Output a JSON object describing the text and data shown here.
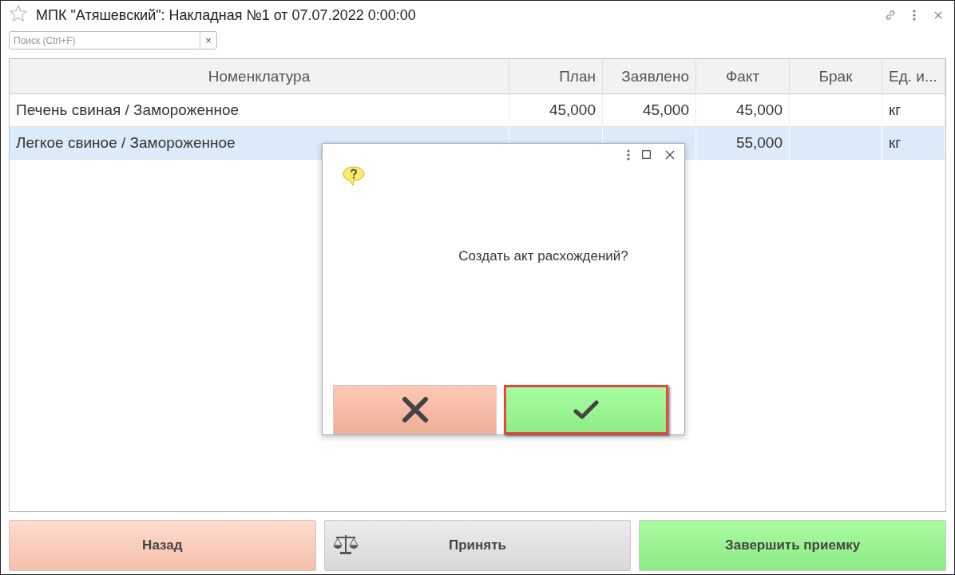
{
  "window": {
    "title": "МПК \"Атяшевский\": Накладная №1 от 07.07.2022 0:00:00",
    "favorite": false
  },
  "search": {
    "placeholder": "Поиск (Ctrl+F)",
    "clear": "×"
  },
  "table": {
    "columns": [
      "Номенклатура",
      "План",
      "Заявлено",
      "Факт",
      "Брак",
      "Ед. и..."
    ],
    "rows": [
      {
        "cells": [
          "Печень свиная / Замороженное",
          "45,000",
          "45,000",
          "45,000",
          null,
          "кг"
        ],
        "selected": false
      },
      {
        "cells": [
          "Легкое свиное / Замороженное",
          null,
          null,
          "55,000",
          null,
          "кг"
        ],
        "selected": true
      }
    ]
  },
  "dialog": {
    "message": "Создать акт расхождений?",
    "buttons": [
      {
        "kind": "cancel",
        "focused": false
      },
      {
        "kind": "ok",
        "focused": true
      }
    ]
  },
  "buttons": [
    {
      "label": "Назад",
      "kind": "back"
    },
    {
      "label": "Принять",
      "kind": "accept"
    },
    {
      "label": "Завершить приемку",
      "kind": "finish"
    }
  ]
}
